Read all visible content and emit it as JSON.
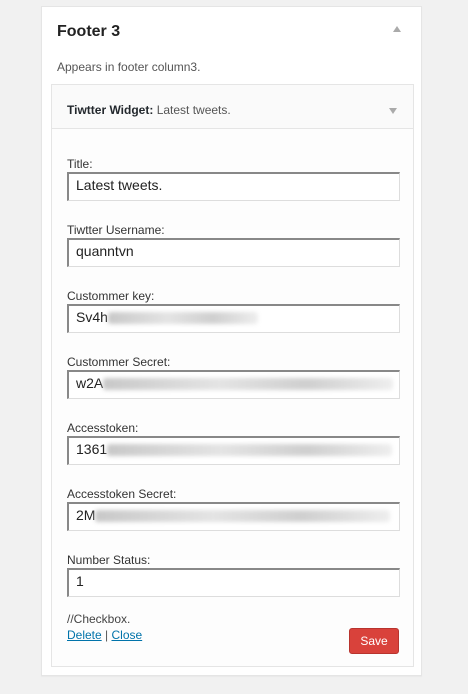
{
  "sidebar": {
    "name": "Footer 3",
    "description": "Appears in footer column3."
  },
  "widget": {
    "title_strong": "Tiwtter Widget",
    "title_separator": ": ",
    "title_instance": "Latest tweets.",
    "fields": [
      {
        "label": "Title:",
        "value": "Latest tweets."
      },
      {
        "label": "Tiwtter Username:",
        "value": "quanntvn"
      },
      {
        "label": "Custommer key:",
        "value": "Sv4h"
      },
      {
        "label": "Custommer Secret:",
        "value": "w2A"
      },
      {
        "label": "Accesstoken:",
        "value": "1361"
      },
      {
        "label": "Accesstoken Secret:",
        "value": "2M"
      },
      {
        "label": "Number Status:",
        "value": "1"
      }
    ],
    "checkbox_note": "//Checkbox.",
    "delete_label": "Delete",
    "link_separator": " | ",
    "close_label": "Close",
    "save_label": "Save"
  },
  "colors": {
    "save_button": "#d9423b",
    "link": "#0073aa"
  }
}
